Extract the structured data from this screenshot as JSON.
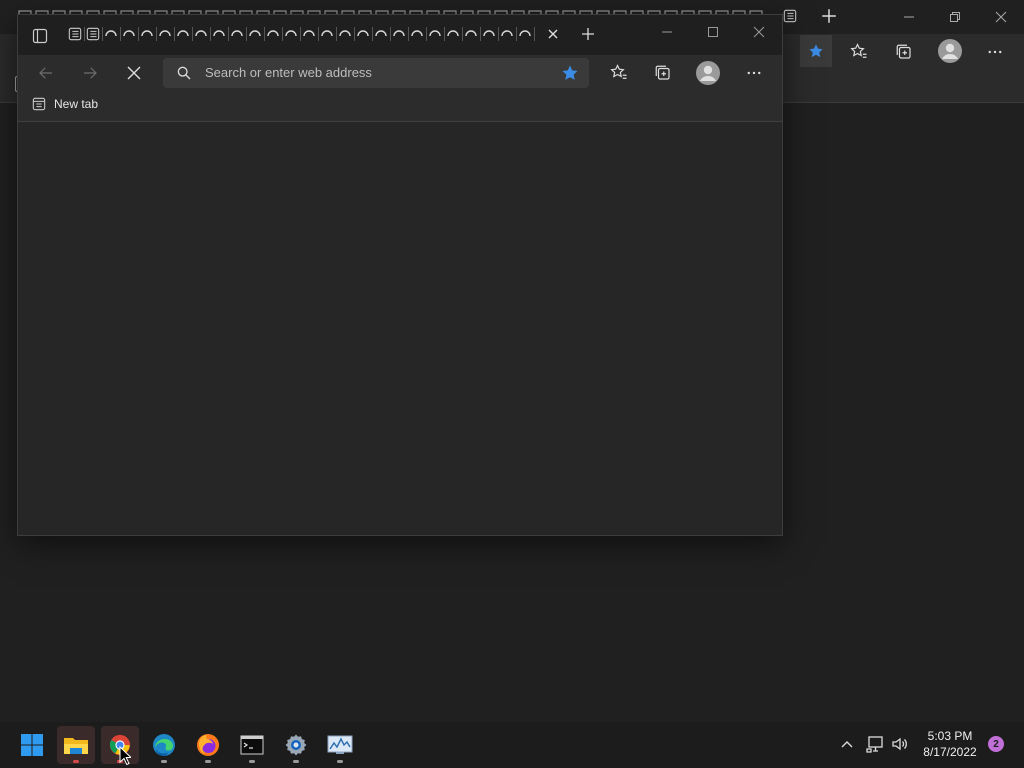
{
  "fg_window": {
    "address_bar": {
      "placeholder": "Search or enter web address"
    },
    "favorites_bar": {
      "items": [
        {
          "label": "New tab"
        }
      ]
    }
  },
  "taskbar": {
    "apps": [
      {
        "name": "start-icon"
      },
      {
        "name": "file-explorer-icon"
      },
      {
        "name": "chrome-icon"
      },
      {
        "name": "edge-icon"
      },
      {
        "name": "firefox-icon"
      },
      {
        "name": "terminal-icon"
      },
      {
        "name": "settings-icon"
      },
      {
        "name": "resource-monitor-icon"
      }
    ],
    "clock": {
      "time": "5:03 PM",
      "date": "8/17/2022"
    },
    "notifications": {
      "count": "2"
    }
  },
  "colors": {
    "accent_blue": "#3b8ce6",
    "notification": "#c06fd6",
    "background": "#202020"
  }
}
